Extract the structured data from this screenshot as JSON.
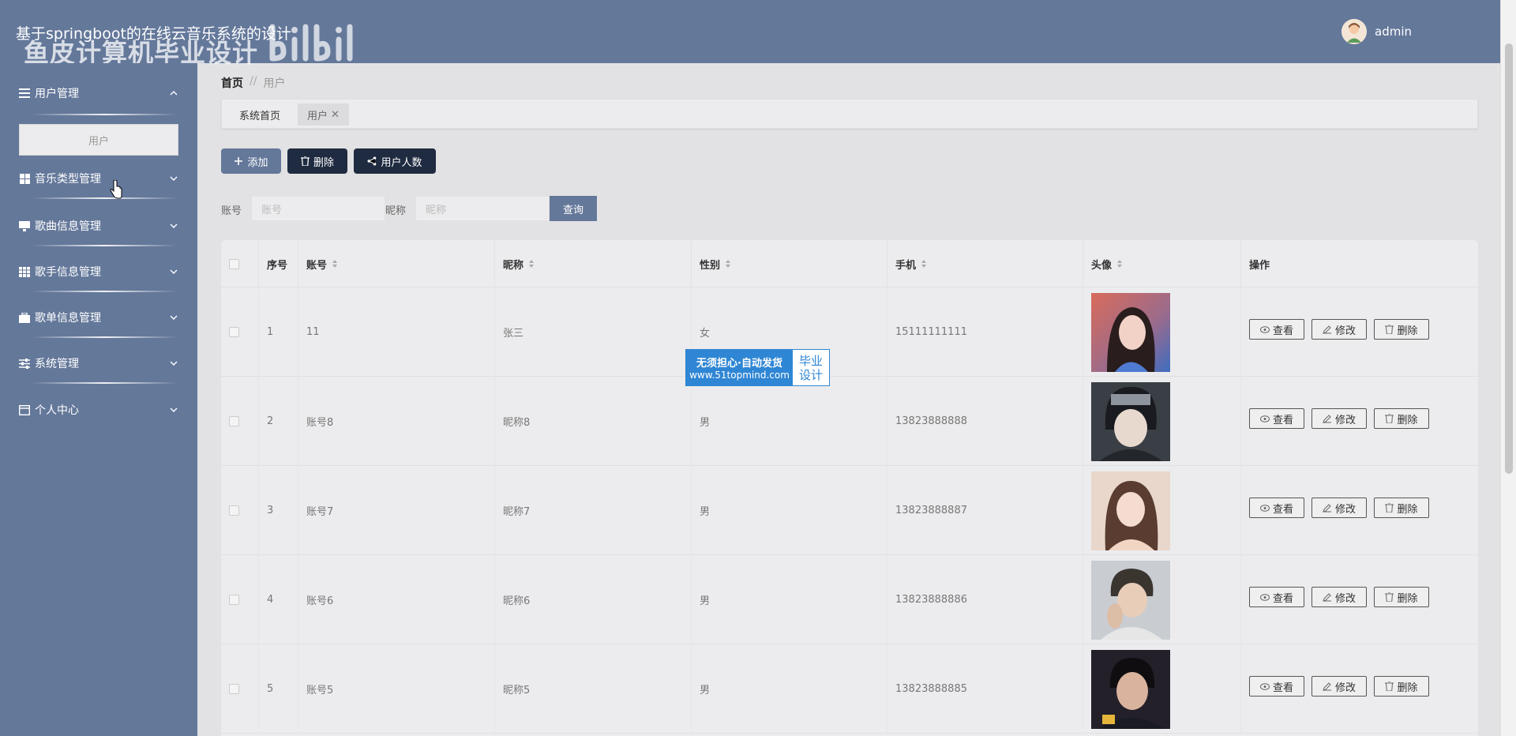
{
  "header": {
    "title": "基于springboot的在线云音乐系统的设计",
    "watermark": "鱼皮计算机毕业设计",
    "username": "admin"
  },
  "sidebar": {
    "items": [
      {
        "label": "用户管理",
        "icon": "list-icon",
        "expanded": true
      },
      {
        "label": "音乐类型管理",
        "icon": "grid-icon"
      },
      {
        "label": "歌曲信息管理",
        "icon": "monitor-icon"
      },
      {
        "label": "歌手信息管理",
        "icon": "table-icon"
      },
      {
        "label": "歌单信息管理",
        "icon": "briefcase-icon"
      },
      {
        "label": "系统管理",
        "icon": "sliders-icon"
      },
      {
        "label": "个人中心",
        "icon": "card-icon"
      }
    ],
    "sub_item": "用户"
  },
  "breadcrumb": {
    "home": "首页",
    "separator": "//",
    "current": "用户"
  },
  "tabs": {
    "home": "系统首页",
    "active": "用户",
    "close": "✕"
  },
  "toolbar": {
    "add": "添加",
    "delete": "删除",
    "user_count": "用户人数"
  },
  "search": {
    "account_label": "账号",
    "account_placeholder": "账号",
    "nickname_label": "昵称",
    "nickname_placeholder": "昵称",
    "query": "查询"
  },
  "table": {
    "headers": {
      "index": "序号",
      "account": "账号",
      "nickname": "昵称",
      "gender": "性别",
      "phone": "手机",
      "avatar": "头像",
      "actions": "操作"
    },
    "rows": [
      {
        "index": "1",
        "account": "11",
        "nickname": "张三",
        "gender": "女",
        "phone": "15111111111"
      },
      {
        "index": "2",
        "account": "账号8",
        "nickname": "昵称8",
        "gender": "男",
        "phone": "13823888888"
      },
      {
        "index": "3",
        "account": "账号7",
        "nickname": "昵称7",
        "gender": "男",
        "phone": "13823888887"
      },
      {
        "index": "4",
        "account": "账号6",
        "nickname": "昵称6",
        "gender": "男",
        "phone": "13823888886"
      },
      {
        "index": "5",
        "account": "账号5",
        "nickname": "昵称5",
        "gender": "男",
        "phone": "13823888885"
      }
    ],
    "actions": {
      "view": "查看",
      "edit": "修改",
      "delete": "删除"
    }
  },
  "ad": {
    "line1": "无须担心·自动发货",
    "line2": "www.51topmind.com",
    "right1": "毕业",
    "right2": "设计"
  },
  "colors": {
    "primary": "#64789a",
    "dark": "#1f2b40",
    "background": "#e2e2e4"
  }
}
